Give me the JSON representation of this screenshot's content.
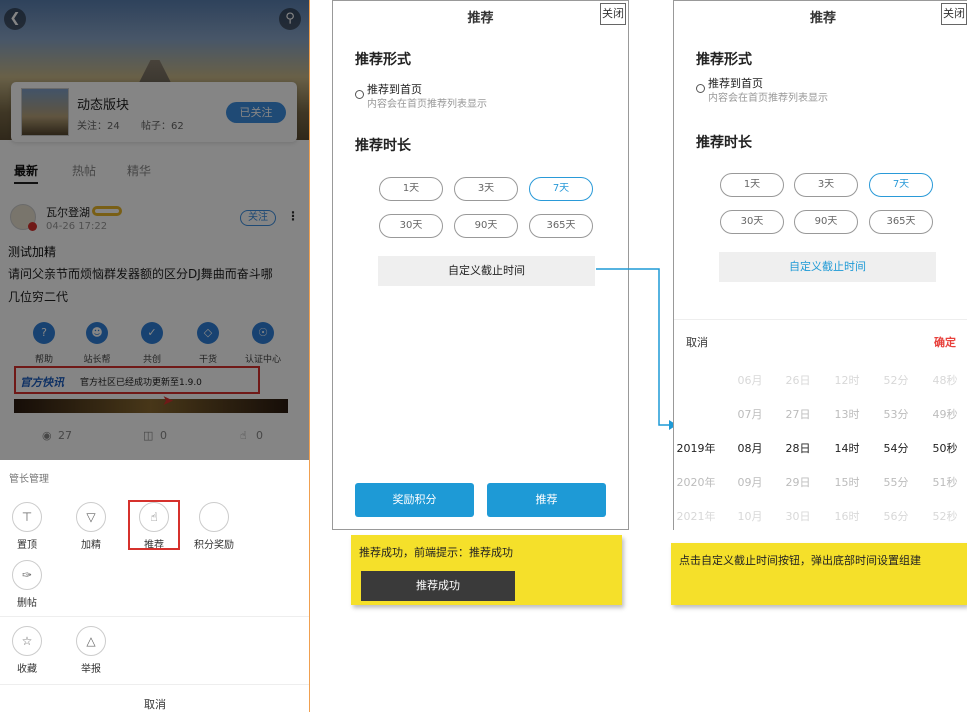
{
  "panel1": {
    "board_name": "动态版块",
    "follow_count": "关注：24",
    "post_count": "帖子：62",
    "followed_label": "已关注",
    "tabs": [
      "最新",
      "热帖",
      "精华"
    ],
    "author": "瓦尔登湖",
    "post_time": "04-26 17:22",
    "follow_label": "关注",
    "post_title": "测试加精",
    "post_body_1": "请问父亲节而烦恼群发器额的区分DJ舞曲而奋斗哪",
    "post_body_2": "几位穷二代",
    "quick_items": [
      "帮助",
      "站长帮",
      "共创",
      "干货",
      "认证中心"
    ],
    "notice_brand": "官方快讯",
    "notice_text": "官方社区已经成功更新至1.9.0",
    "views": "27",
    "comments": "0",
    "likes": "0",
    "sheet_title": "管长管理",
    "actions_row1": [
      "置顶",
      "加精",
      "推荐",
      "积分奖励"
    ],
    "action_delete": "删帖",
    "actions_row3": [
      "收藏",
      "举报"
    ],
    "cancel": "取消"
  },
  "panel2": {
    "title": "推荐",
    "close": "关闭",
    "form_label": "推荐形式",
    "option": "推荐到首页",
    "option_sub": "内容会在首页推荐列表显示",
    "duration_label": "推荐时长",
    "durations": [
      "1天",
      "3天",
      "7天",
      "30天",
      "90天",
      "365天"
    ],
    "selected_duration": "7天",
    "custom_label": "自定义截止时间",
    "reward_button": "奖励积分",
    "recommend_button": "推荐",
    "note": "推荐成功，前端提示：推荐成功",
    "toast": "推荐成功"
  },
  "panel3": {
    "title": "推荐",
    "close": "关闭",
    "form_label": "推荐形式",
    "option": "推荐到首页",
    "option_sub": "内容会在首页推荐列表显示",
    "duration_label": "推荐时长",
    "durations": [
      "1天",
      "3天",
      "7天",
      "30天",
      "90天",
      "365天"
    ],
    "custom_label": "自定义截止时间",
    "picker_cancel": "取消",
    "picker_confirm": "确定",
    "picker_rows": [
      [
        "",
        "06月",
        "26日",
        "12时",
        "52分",
        "48秒"
      ],
      [
        "",
        "07月",
        "27日",
        "13时",
        "53分",
        "49秒"
      ],
      [
        "2019年",
        "08月",
        "28日",
        "14时",
        "54分",
        "50秒"
      ],
      [
        "2020年",
        "09月",
        "29日",
        "15时",
        "55分",
        "51秒"
      ],
      [
        "2021年",
        "10月",
        "30日",
        "16时",
        "56分",
        "52秒"
      ]
    ],
    "note": "点击自定义截止时间按钮，弹出底部时间设置组建"
  },
  "colors": {
    "accent": "#1e9ad6",
    "danger": "#d6312c",
    "sticky": "#f5e02a",
    "confirm": "#e8413c"
  }
}
